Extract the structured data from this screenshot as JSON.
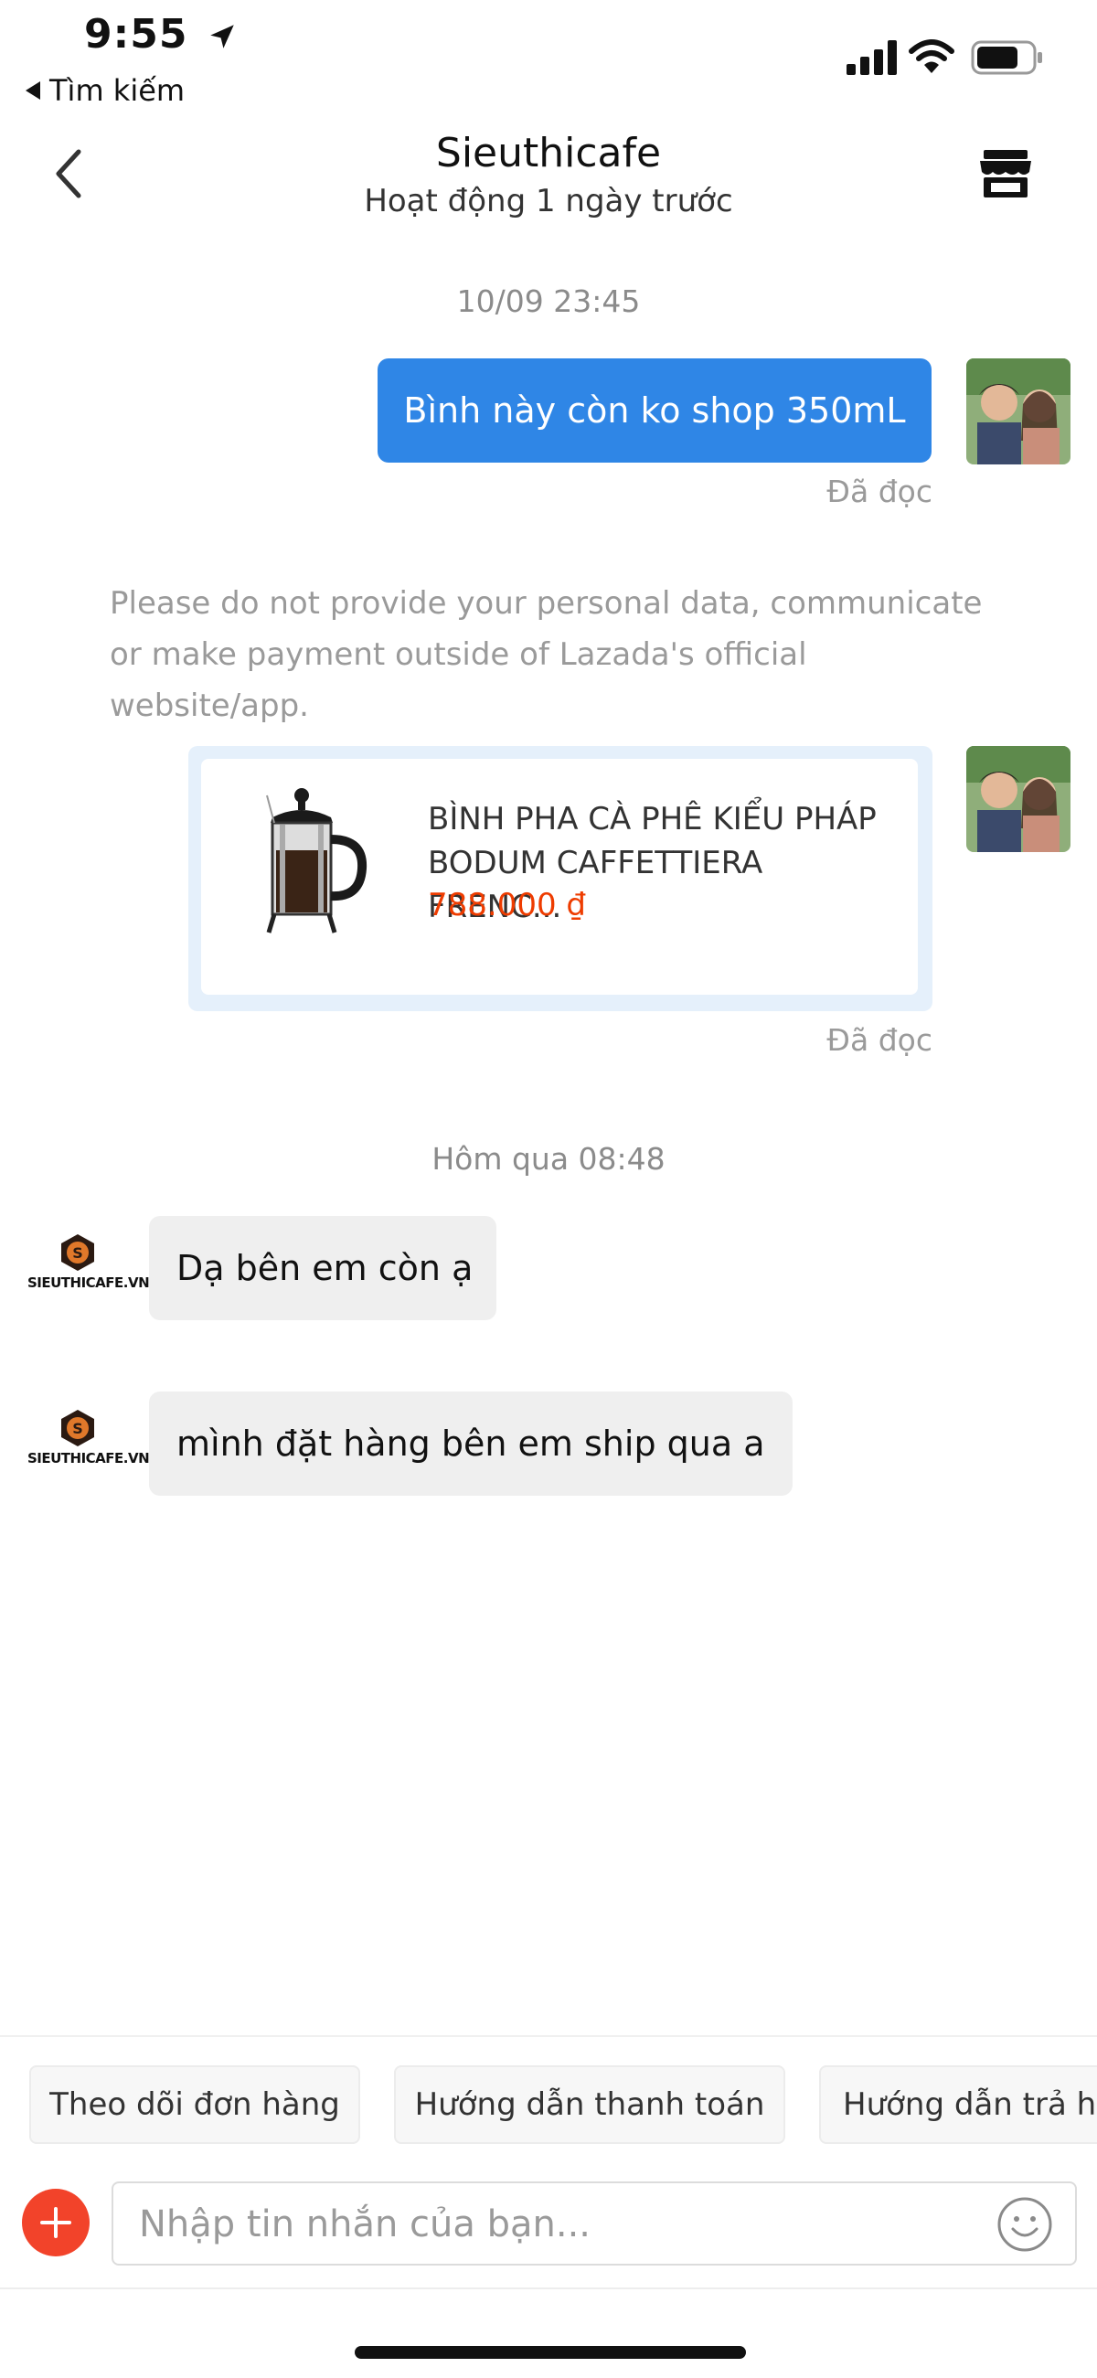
{
  "status_bar": {
    "time": "9:55",
    "back_label": "Tìm kiếm"
  },
  "header": {
    "title": "Sieuthicafe",
    "subtitle": "Hoạt động 1 ngày trước"
  },
  "messages": {
    "timestamp_1": "10/09 23:45",
    "msg_1": "Bình này còn ko shop 350mL",
    "read_1": "Đã đọc",
    "notice": "Please do not provide your personal data, communicate or make payment outside of Lazada's official website/app.",
    "product": {
      "name": "BÌNH PHA CÀ PHÊ KIỂU PHÁP BODUM CAFFETTIERA FRENC...",
      "price": "788.000 ₫"
    },
    "read_2": "Đã đọc",
    "timestamp_2": "Hôm qua 08:48",
    "shop_reply_1": "Dạ bên em còn ạ",
    "shop_reply_2": "mình đặt hàng bên em ship qua a",
    "shop_logo_text": "SIEUTHICAFE.VN"
  },
  "quick_replies": [
    "Theo dõi đơn hàng",
    "Hướng dẫn thanh toán",
    "Hướng dẫn trả hà"
  ],
  "input": {
    "placeholder": "Nhập tin nhắn của bạn..."
  },
  "colors": {
    "outgoing_bubble": "#2f86e6",
    "price": "#ee3c00",
    "plus_button": "#f2432a"
  }
}
